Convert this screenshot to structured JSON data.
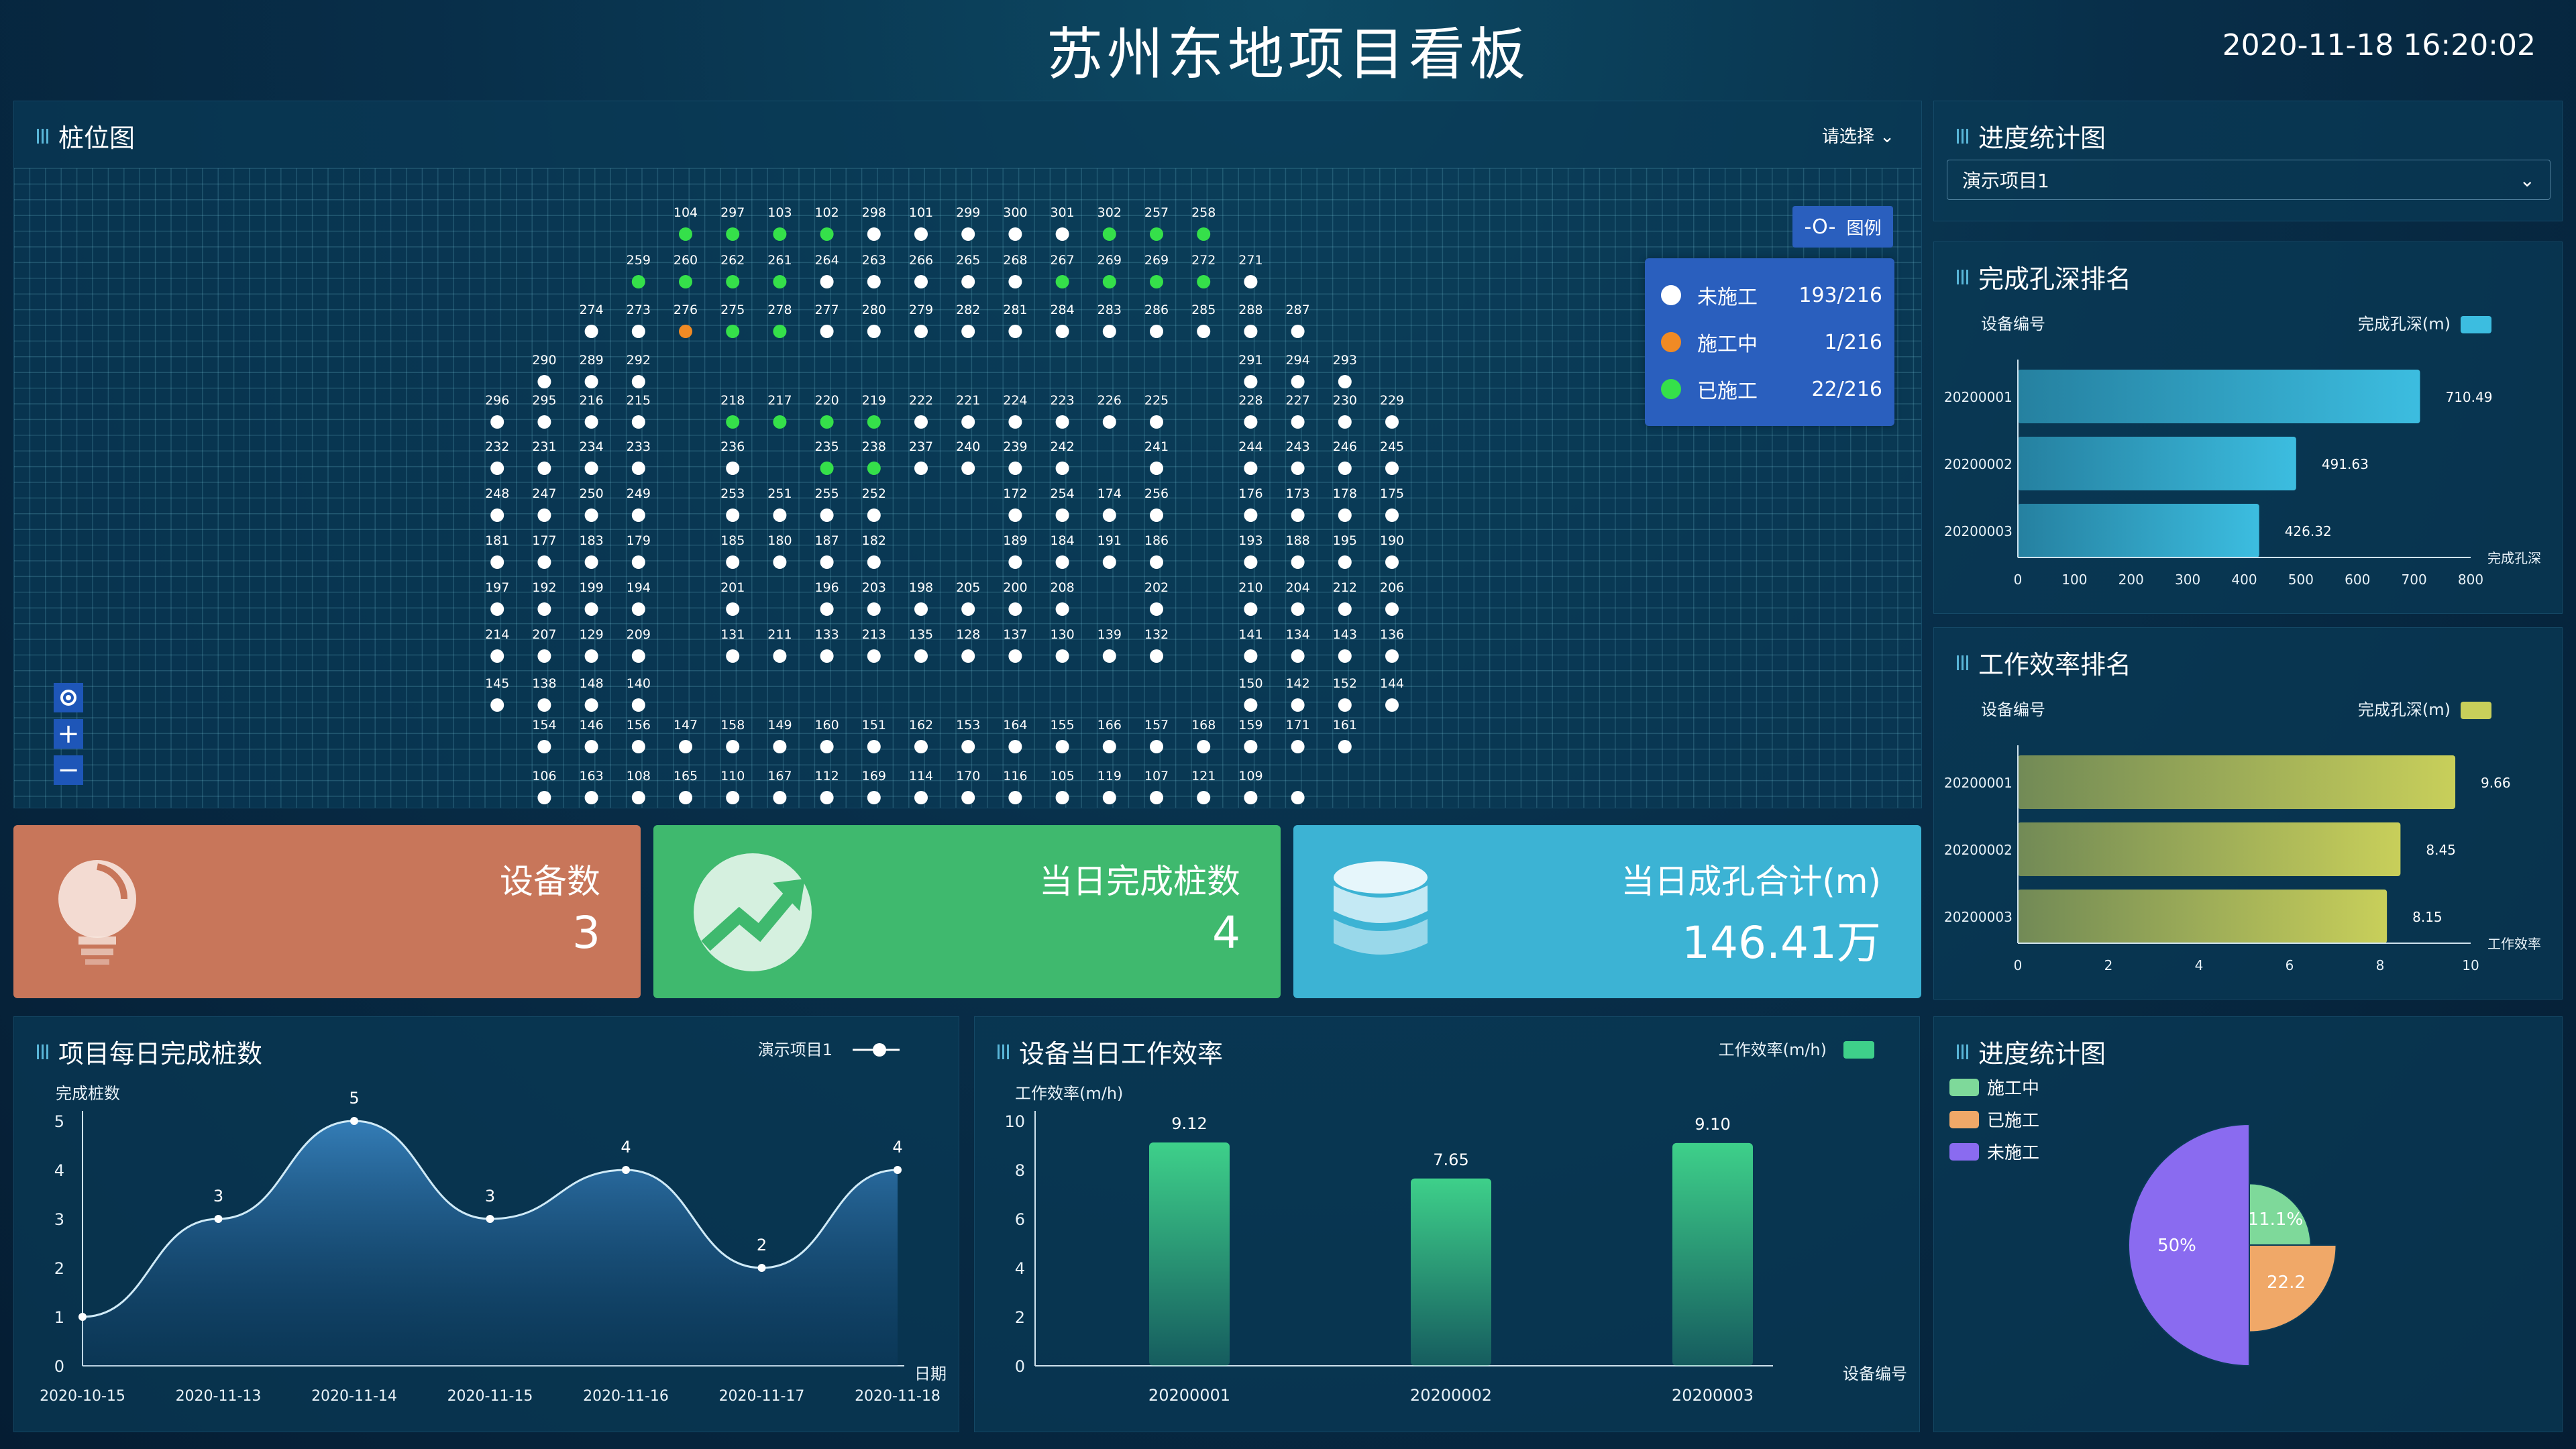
{
  "header": {
    "title": "苏州东地项目看板",
    "datetime": "2020-11-18 16:20:02"
  },
  "pile_map": {
    "title": "桩位图",
    "select_label": "请选择",
    "legend_button": "图例",
    "legend": [
      {
        "label": "未施工",
        "value": "193/216",
        "color": "#ffffff"
      },
      {
        "label": "施工中",
        "value": "1/216",
        "color": "#f08a24"
      },
      {
        "label": "已施工",
        "value": "22/216",
        "color": "#35e04a"
      }
    ],
    "rows": [
      {
        "cols": [
          14,
          15,
          16,
          17,
          18,
          19,
          20,
          21,
          22,
          23,
          24,
          25
        ],
        "labels": [
          "104",
          "297",
          "103",
          "102",
          "298",
          "101",
          "299",
          "300",
          "301",
          "302",
          "257",
          "258"
        ],
        "status": [
          "done",
          "done",
          "done",
          "done",
          "none",
          "none",
          "none",
          "none",
          "none",
          "done",
          "done",
          "done"
        ]
      },
      {
        "cols": [
          13,
          14,
          15,
          16,
          17,
          18,
          19,
          20,
          21,
          22,
          23,
          24,
          25,
          26
        ],
        "labels": [
          "259",
          "260",
          "262",
          "261",
          "264",
          "263",
          "266",
          "265",
          "268",
          "267",
          "269",
          "269",
          "272",
          "271"
        ],
        "status": [
          "done",
          "done",
          "done",
          "done",
          "none",
          "none",
          "none",
          "none",
          "none",
          "done",
          "done",
          "done",
          "done",
          "none"
        ]
      },
      {
        "cols": [
          12,
          13,
          14,
          15,
          16,
          17,
          18,
          19,
          20,
          21,
          22,
          23,
          24,
          25,
          26,
          27
        ],
        "labels": [
          "274",
          "273",
          "276",
          "275",
          "278",
          "277",
          "280",
          "279",
          "282",
          "281",
          "284",
          "283",
          "286",
          "285",
          "288",
          "287"
        ],
        "status": [
          "none",
          "none",
          "prog",
          "done",
          "done",
          "none",
          "none",
          "none",
          "none",
          "none",
          "none",
          "none",
          "none",
          "none",
          "none",
          "none"
        ]
      },
      {
        "cols": [
          11,
          12,
          13,
          26,
          27,
          28
        ],
        "labels": [
          "290",
          "289",
          "292",
          "291",
          "294",
          "293"
        ],
        "status": [
          "none",
          "none",
          "none",
          "none",
          "none",
          "none"
        ]
      },
      {
        "cols": [
          10,
          11,
          12,
          13,
          15,
          16,
          17,
          18,
          19,
          20,
          21,
          22,
          23,
          24,
          26,
          27,
          28,
          29
        ],
        "labels": [
          "296",
          "295",
          "216",
          "215",
          "218",
          "217",
          "220",
          "219",
          "222",
          "221",
          "224",
          "223",
          "226",
          "225",
          "228",
          "227",
          "230",
          "229"
        ],
        "status": [
          "none",
          "none",
          "none",
          "none",
          "done",
          "done",
          "done",
          "done",
          "none",
          "none",
          "none",
          "none",
          "none",
          "none",
          "none",
          "none",
          "none",
          "none"
        ]
      },
      {
        "cols": [
          10,
          11,
          12,
          13,
          15,
          17,
          18,
          19,
          20,
          21,
          22,
          24,
          26,
          27,
          28,
          29
        ],
        "labels": [
          "232",
          "231",
          "234",
          "233",
          "236",
          "235",
          "238",
          "237",
          "240",
          "239",
          "242",
          "241",
          "244",
          "243",
          "246",
          "245"
        ],
        "status": [
          "none",
          "none",
          "none",
          "none",
          "none",
          "done",
          "done",
          "none",
          "none",
          "none",
          "none",
          "none",
          "none",
          "none",
          "none",
          "none"
        ]
      },
      {
        "cols": [
          10,
          11,
          12,
          13,
          15,
          16,
          17,
          18,
          21,
          22,
          23,
          24,
          26,
          27,
          28,
          29
        ],
        "labels": [
          "248",
          "247",
          "250",
          "249",
          "253",
          "251",
          "255",
          "252",
          "172",
          "254",
          "174",
          "256",
          "176",
          "173",
          "178",
          "175"
        ],
        "status": [
          "none",
          "none",
          "none",
          "none",
          "none",
          "none",
          "none",
          "none",
          "none",
          "none",
          "none",
          "none",
          "none",
          "none",
          "none",
          "none"
        ]
      },
      {
        "cols": [
          10,
          11,
          12,
          13,
          15,
          16,
          17,
          18,
          21,
          22,
          23,
          24,
          26,
          27,
          28,
          29
        ],
        "labels": [
          "181",
          "177",
          "183",
          "179",
          "185",
          "180",
          "187",
          "182",
          "189",
          "184",
          "191",
          "186",
          "193",
          "188",
          "195",
          "190"
        ],
        "status": [
          "none",
          "none",
          "none",
          "none",
          "none",
          "none",
          "none",
          "none",
          "none",
          "none",
          "none",
          "none",
          "none",
          "none",
          "none",
          "none"
        ]
      },
      {
        "cols": [
          10,
          11,
          12,
          13,
          15,
          17,
          18,
          19,
          20,
          21,
          22,
          24,
          26,
          27,
          28,
          29
        ],
        "labels": [
          "197",
          "192",
          "199",
          "194",
          "201",
          "196",
          "203",
          "198",
          "205",
          "200",
          "208",
          "202",
          "210",
          "204",
          "212",
          "206"
        ],
        "status": [
          "none",
          "none",
          "none",
          "none",
          "none",
          "none",
          "none",
          "none",
          "none",
          "none",
          "none",
          "none",
          "none",
          "none",
          "none",
          "none"
        ]
      },
      {
        "cols": [
          10,
          11,
          12,
          13,
          15,
          16,
          17,
          18,
          19,
          20,
          21,
          22,
          23,
          24,
          26,
          27,
          28,
          29
        ],
        "labels": [
          "214",
          "207",
          "129",
          "209",
          "131",
          "211",
          "133",
          "213",
          "135",
          "128",
          "137",
          "130",
          "139",
          "132",
          "141",
          "134",
          "143",
          "136"
        ],
        "status": [
          "none",
          "none",
          "none",
          "none",
          "none",
          "none",
          "none",
          "none",
          "none",
          "none",
          "none",
          "none",
          "none",
          "none",
          "none",
          "none",
          "none",
          "none"
        ]
      },
      {
        "cols": [
          10,
          11,
          12,
          13,
          26,
          27,
          28,
          29
        ],
        "labels": [
          "145",
          "138",
          "148",
          "140",
          "150",
          "142",
          "152",
          "144"
        ],
        "status": [
          "none",
          "none",
          "none",
          "none",
          "none",
          "none",
          "none",
          "none"
        ]
      },
      {
        "cols": [
          11,
          12,
          13,
          14,
          15,
          16,
          17,
          18,
          19,
          20,
          21,
          22,
          23,
          24,
          25,
          26,
          27,
          28
        ],
        "labels": [
          "154",
          "146",
          "156",
          "147",
          "158",
          "149",
          "160",
          "151",
          "162",
          "153",
          "164",
          "155",
          "166",
          "157",
          "168",
          "159",
          "171",
          "161"
        ],
        "status": [
          "none",
          "none",
          "none",
          "none",
          "none",
          "none",
          "none",
          "none",
          "none",
          "none",
          "none",
          "none",
          "none",
          "none",
          "none",
          "none",
          "none",
          "none"
        ]
      },
      {
        "cols": [
          11,
          12,
          13,
          14,
          15,
          16,
          17,
          18,
          19,
          20,
          21,
          22,
          23,
          24,
          25,
          26,
          27
        ],
        "labels": [
          "106",
          "163",
          "108",
          "165",
          "110",
          "167",
          "112",
          "169",
          "114",
          "170",
          "116",
          "105",
          "119",
          "107",
          "121",
          "109"
        ],
        "status": [
          "none",
          "none",
          "none",
          "none",
          "none",
          "none",
          "none",
          "none",
          "none",
          "none",
          "none",
          "none",
          "none",
          "none",
          "none",
          "none"
        ]
      }
    ]
  },
  "cards": [
    {
      "label": "设备数",
      "value": "3",
      "icon": "lightbulb-icon"
    },
    {
      "label": "当日完成桩数",
      "value": "4",
      "icon": "trend-up-icon"
    },
    {
      "label": "当日成孔合计(m)",
      "value": "146.41万",
      "icon": "database-icon"
    }
  ],
  "progress_select": {
    "title": "进度统计图",
    "value": "演示项目1"
  },
  "depth_rank": {
    "title": "完成孔深排名",
    "chart_data": {
      "type": "bar",
      "orientation": "horizontal",
      "ylabel": "设备编号",
      "legend": "完成孔深(m)",
      "xlabel": "完成孔深",
      "categories": [
        "20200001",
        "20200002",
        "20200003"
      ],
      "values": [
        710.49,
        491.63,
        426.32
      ],
      "value_labels": [
        "710.49",
        "491.63",
        "426.32"
      ],
      "xlim": [
        0,
        800
      ],
      "ticks": [
        "0",
        "100",
        "200",
        "300",
        "400",
        "500",
        "600",
        "700",
        "800"
      ],
      "color": "#3cbde0"
    }
  },
  "eff_rank": {
    "title": "工作效率排名",
    "chart_data": {
      "type": "bar",
      "orientation": "horizontal",
      "ylabel": "设备编号",
      "legend": "完成孔深(m)",
      "xlabel": "工作效率",
      "categories": [
        "20200001",
        "20200002",
        "20200003"
      ],
      "values": [
        9.66,
        8.45,
        8.15
      ],
      "value_labels": [
        "9.66",
        "8.45",
        "8.15"
      ],
      "xlim": [
        0,
        10
      ],
      "ticks": [
        "0",
        "2",
        "4",
        "6",
        "8",
        "10"
      ],
      "color": "#c8cf5a"
    }
  },
  "daily_piles": {
    "title": "项目每日完成桩数",
    "legend": "演示项目1",
    "chart_data": {
      "type": "area",
      "ylabel": "完成桩数",
      "xlabel": "日期",
      "categories": [
        "2020-10-15",
        "2020-11-13",
        "2020-11-14",
        "2020-11-15",
        "2020-11-16",
        "2020-11-17",
        "2020-11-18"
      ],
      "series": [
        {
          "values": [
            1,
            3,
            5,
            3,
            4,
            2,
            4
          ]
        }
      ],
      "ylim": [
        0,
        5
      ],
      "y_ticks": [
        "0",
        "1",
        "2",
        "3",
        "4",
        "5"
      ],
      "value_labels": [
        "",
        "3",
        "5",
        "3",
        "4",
        "2",
        "4"
      ]
    }
  },
  "device_eff": {
    "title": "设备当日工作效率",
    "legend": "工作效率(m/h)",
    "chart_data": {
      "type": "bar",
      "ylabel": "工作效率(m/h)",
      "xlabel": "设备编号",
      "categories": [
        "20200001",
        "20200002",
        "20200003"
      ],
      "values": [
        9.12,
        7.65,
        9.1
      ],
      "value_labels": [
        "9.12",
        "7.65",
        "9.10"
      ],
      "ylim": [
        0,
        10
      ],
      "y_ticks": [
        "0",
        "2",
        "4",
        "6",
        "8",
        "10"
      ],
      "color": "#3ed08a"
    }
  },
  "progress_pie": {
    "title": "进度统计图",
    "chart_data": {
      "type": "pie",
      "legend": [
        {
          "label": "施工中",
          "color": "#7ed99a"
        },
        {
          "label": "已施工",
          "color": "#f0a868"
        },
        {
          "label": "未施工",
          "color": "#8a6bf0"
        }
      ],
      "slices": [
        {
          "label": "施工中",
          "value": 11.1,
          "text": "11.1%",
          "color": "#7ed99a"
        },
        {
          "label": "已施工",
          "value": 22.2,
          "text": "22.2",
          "color": "#f0a868"
        },
        {
          "label": "未施工",
          "value": 50,
          "text": "50%",
          "color": "#8a6bf0"
        }
      ]
    }
  }
}
